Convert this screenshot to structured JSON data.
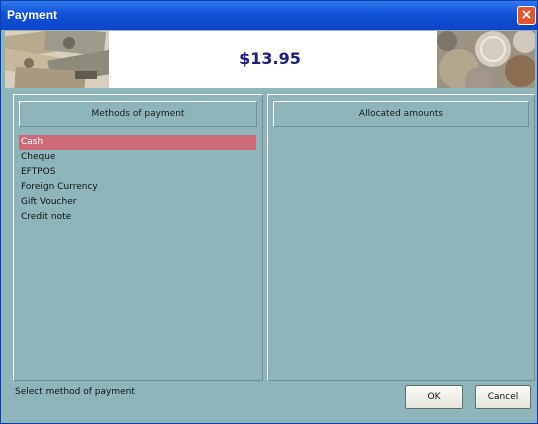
{
  "window": {
    "title": "Payment",
    "close_glyph": "×"
  },
  "banner": {
    "amount": "$13.95",
    "left_image": "banknotes-image",
    "right_image": "coins-image"
  },
  "left_panel": {
    "header": "Methods of payment",
    "methods": [
      "Cash",
      "Cheque",
      "EFTPOS",
      "Foreign Currency",
      "Gift Voucher",
      "Credit note"
    ],
    "selected": "Cash"
  },
  "right_panel": {
    "header": "Allocated amounts"
  },
  "status": "Select method of payment",
  "buttons": {
    "ok": "OK",
    "cancel": "Cancel"
  },
  "colors": {
    "titlebar": "#0b45c6",
    "dialog": "#8fb5bb",
    "selection": "#cc6a79",
    "amount_text": "#1c1c7a"
  }
}
